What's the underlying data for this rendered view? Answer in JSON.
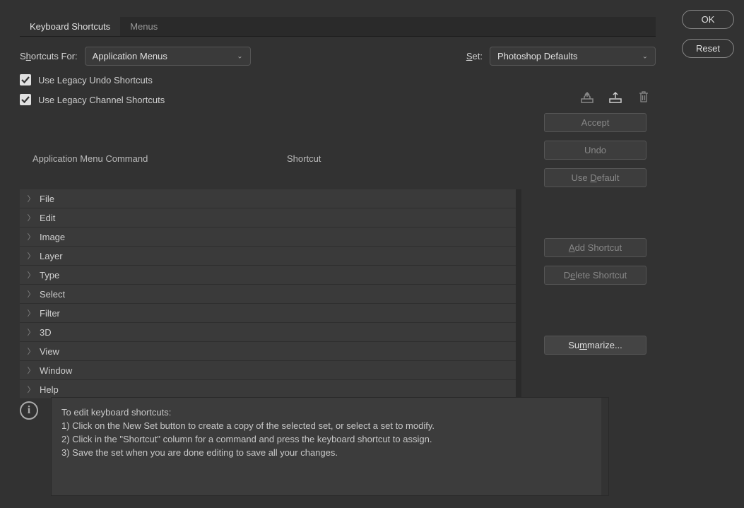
{
  "tabs": {
    "shortcuts": "Keyboard Shortcuts",
    "menus": "Menus"
  },
  "labels": {
    "shortcuts_for_pre": "S",
    "shortcuts_for_mid": "h",
    "shortcuts_for_post": "ortcuts For:",
    "set_pre": "S",
    "set_post": "et:"
  },
  "selects": {
    "shortcuts_for": "Application Menus",
    "set": "Photoshop Defaults"
  },
  "checks": {
    "legacy_undo": "Use Legacy Undo Shortcuts",
    "legacy_channel": "Use Legacy Channel Shortcuts"
  },
  "table": {
    "header_cmd": "Application Menu Command",
    "header_shortcut": "Shortcut",
    "rows": [
      "File",
      "Edit",
      "Image",
      "Layer",
      "Type",
      "Select",
      "Filter",
      "3D",
      "View",
      "Window",
      "Help"
    ]
  },
  "buttons": {
    "accept": "Accept",
    "undo": "Undo",
    "use_default_pre": "Use ",
    "use_default_u": "D",
    "use_default_post": "efault",
    "add_pre": "A",
    "add_post": "dd Shortcut",
    "delete_pre": "D",
    "delete_u": "e",
    "delete_post": "lete Shortcut",
    "summarize_pre": "Su",
    "summarize_u": "m",
    "summarize_post": "marize...",
    "ok": "OK",
    "reset": "Reset"
  },
  "info": {
    "l1": "To edit keyboard shortcuts:",
    "l2": "1) Click on the New Set button to create a copy of the selected set, or select a set to modify.",
    "l3": "2) Click in the \"Shortcut\" column for a command and press the keyboard shortcut to assign.",
    "l4": "3) Save the set when you are done editing to save all your changes."
  }
}
